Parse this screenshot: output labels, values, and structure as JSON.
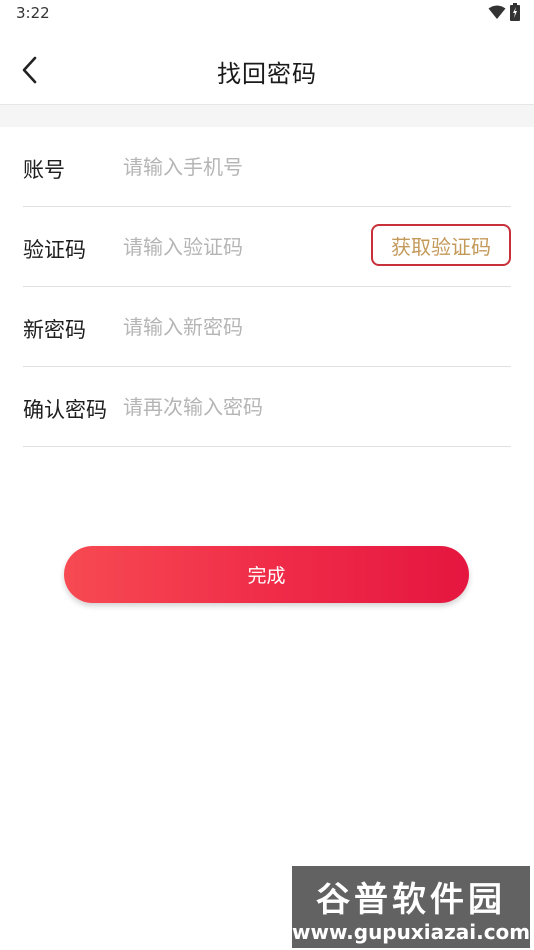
{
  "status_bar": {
    "time": "3:22",
    "icons": [
      "wifi-icon",
      "battery-icon"
    ]
  },
  "header": {
    "title": "找回密码",
    "back_icon": "chevron-left-icon"
  },
  "form": {
    "account": {
      "label": "账号",
      "placeholder": "请输入手机号",
      "value": ""
    },
    "code": {
      "label": "验证码",
      "placeholder": "请输入验证码",
      "value": "",
      "button_label": "获取验证码"
    },
    "new_password": {
      "label": "新密码",
      "placeholder": "请输入新密码",
      "value": ""
    },
    "confirm_password": {
      "label": "确认密码",
      "placeholder": "请再次输入密码",
      "value": ""
    }
  },
  "actions": {
    "submit_label": "完成"
  },
  "watermark": {
    "title": "谷普软件园",
    "url": "www.gupuxiazai.com"
  },
  "colors": {
    "accent_start": "#f74a52",
    "accent_end": "#e5163f",
    "code_button_border": "#c8303a",
    "code_button_text": "#c49a5a",
    "placeholder": "#b5b5b5",
    "divider": "#e0e0e0"
  }
}
